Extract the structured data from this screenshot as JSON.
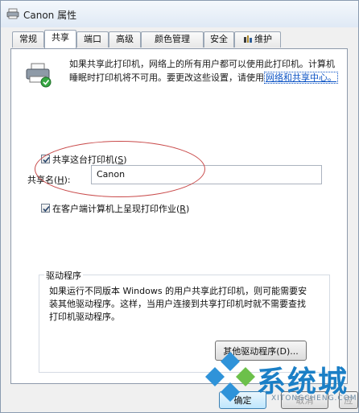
{
  "window": {
    "title": "Canon 属性"
  },
  "tabs": [
    {
      "label": "常规"
    },
    {
      "label": "共享",
      "active": true
    },
    {
      "label": "端口"
    },
    {
      "label": "高级"
    },
    {
      "label": "颜色管理"
    },
    {
      "label": "安全"
    },
    {
      "label": "维护"
    }
  ],
  "sharing": {
    "description_line1": "如果共享此打印机，网络上的所有用户都可以使用此打印机。计算机",
    "description_line2": "睡眠时打印机将不可用。要更改这些设置，请使用",
    "network_center_link": "网络和共享中心。",
    "share_checkbox_label": "共享这台打印机(",
    "share_checkbox_key": "S",
    "share_checkbox_checked": true,
    "share_name_label": "共享名(",
    "share_name_key": "H",
    "share_name_value": "Canon",
    "render_jobs_label": "在客户端计算机上呈现打印作业(",
    "render_jobs_key": "R",
    "render_jobs_checked": true
  },
  "drivers": {
    "group_title": "驱动程序",
    "text_line1": "如果运行不同版本 Windows 的用户共享此打印机，则可能需要安",
    "text_line2": "装其他驱动程序。这样，当用户连接到共享打印机时就不需要查找",
    "text_line3": "打印机驱动程序。",
    "other_drivers_button": "其他驱动程序(D)..."
  },
  "footer": {
    "ok_button": "确定",
    "cancel_button": "取消",
    "apply_button": "应"
  },
  "watermark": {
    "brand": "系统城",
    "url": "XITONGCHENG.COM"
  },
  "colors": {
    "accent_link": "#0a52c4",
    "highlight_ellipse": "#c94a4a",
    "watermark_blue": "#1b7fc6"
  }
}
